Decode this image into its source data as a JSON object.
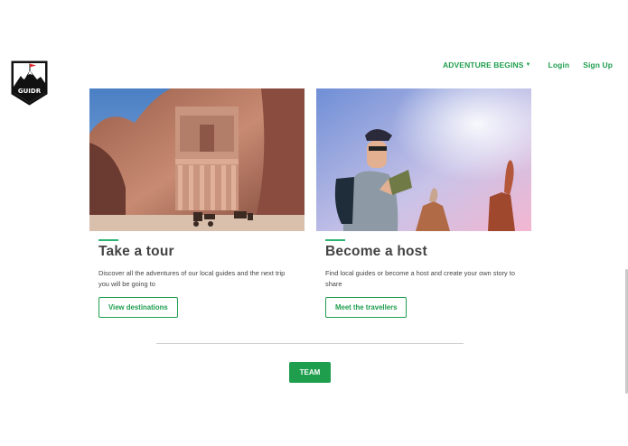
{
  "logo": {
    "text": "GUIDR"
  },
  "nav": {
    "adventure_label": "ADVENTURE BEGINS",
    "login_label": "Login",
    "signup_label": "Sign Up"
  },
  "cards": [
    {
      "title": "Take a tour",
      "description": "Discover all the adventures of our local guides and the next trip you will be going to",
      "button_label": "View destinations"
    },
    {
      "title": "Become a host",
      "description": "Find local guides or become a host and create your own story to share",
      "button_label": "Meet the travellers"
    }
  ],
  "team_button_label": "TEAM",
  "colors": {
    "accent": "#1f9e4e",
    "accent_light": "#2bb673"
  }
}
